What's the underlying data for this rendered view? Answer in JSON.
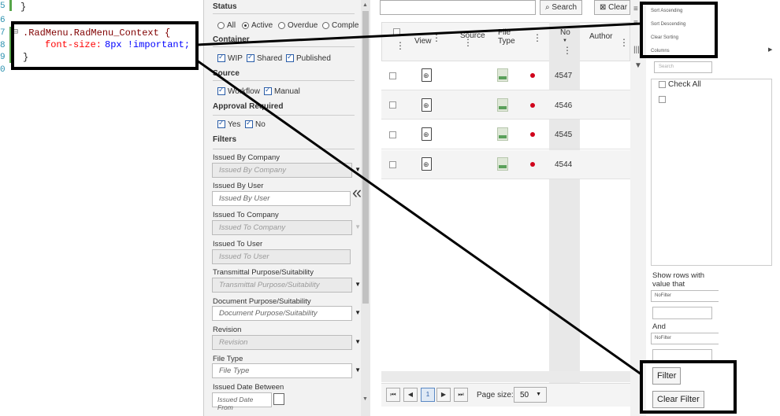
{
  "editor": {
    "line_numbers": [
      "5",
      "6",
      "7",
      "8",
      "9",
      "0"
    ],
    "lines": {
      "l5": "}",
      "l7_sel": ".RadMenu.RadMenu_Context {",
      "l8_prop": "font-size:",
      "l8_val": "8px !important;",
      "l9": "}"
    },
    "collapse_glyph": "⊟"
  },
  "filter_panel": {
    "status": {
      "title": "Status",
      "options": [
        "All",
        "Active",
        "Overdue",
        "Comple"
      ],
      "selected": "Active"
    },
    "container": {
      "title": "Container",
      "options": [
        "WIP",
        "Shared",
        "Published"
      ]
    },
    "source": {
      "title": "Source",
      "options": [
        "Workflow",
        "Manual"
      ]
    },
    "approval": {
      "title": "Approval Required",
      "options": [
        "Yes",
        "No"
      ]
    },
    "filters_title": "Filters",
    "fields": [
      {
        "label": "Issued By Company",
        "placeholder": "Issued By Company"
      },
      {
        "label": "Issued By User",
        "placeholder": "Issued By User"
      },
      {
        "label": "Issued To Company",
        "placeholder": "Issued To Company"
      },
      {
        "label": "Issued To User",
        "placeholder": "Issued To User"
      },
      {
        "label": "Transmittal Purpose/Suitability",
        "placeholder": "Transmittal Purpose/Suitability"
      },
      {
        "label": "Document Purpose/Suitability",
        "placeholder": "Document Purpose/Suitability"
      },
      {
        "label": "Revision",
        "placeholder": "Revision"
      },
      {
        "label": "File Type",
        "placeholder": "File Type"
      },
      {
        "label": "Issued Date Between",
        "placeholder": "Issued Date From"
      }
    ],
    "collapse_glyph": "«"
  },
  "toolbar": {
    "search_label": "Search",
    "clear_label": "Clear"
  },
  "grid": {
    "columns": [
      "View",
      "Source",
      "File Type",
      "No",
      "Author"
    ],
    "rows": [
      {
        "no": "4547"
      },
      {
        "no": "4546"
      },
      {
        "no": "4545"
      },
      {
        "no": "4544"
      }
    ],
    "status_color": "#d0021b"
  },
  "pager": {
    "current_page": "1",
    "page_size_label": "Page size:",
    "page_size": "50"
  },
  "context_menu": {
    "items": [
      "Sort Ascending",
      "Sort Descending",
      "Clear Sorting",
      "Columns"
    ],
    "search_placeholder": "Search",
    "check_all": "Check All",
    "show_rows_label": "Show rows with value that",
    "nofilter_1": "NoFilter",
    "and_label": "And",
    "nofilter_2": "NoFilter",
    "filter_button": "Filter",
    "clear_filter_button": "Clear Filter"
  }
}
